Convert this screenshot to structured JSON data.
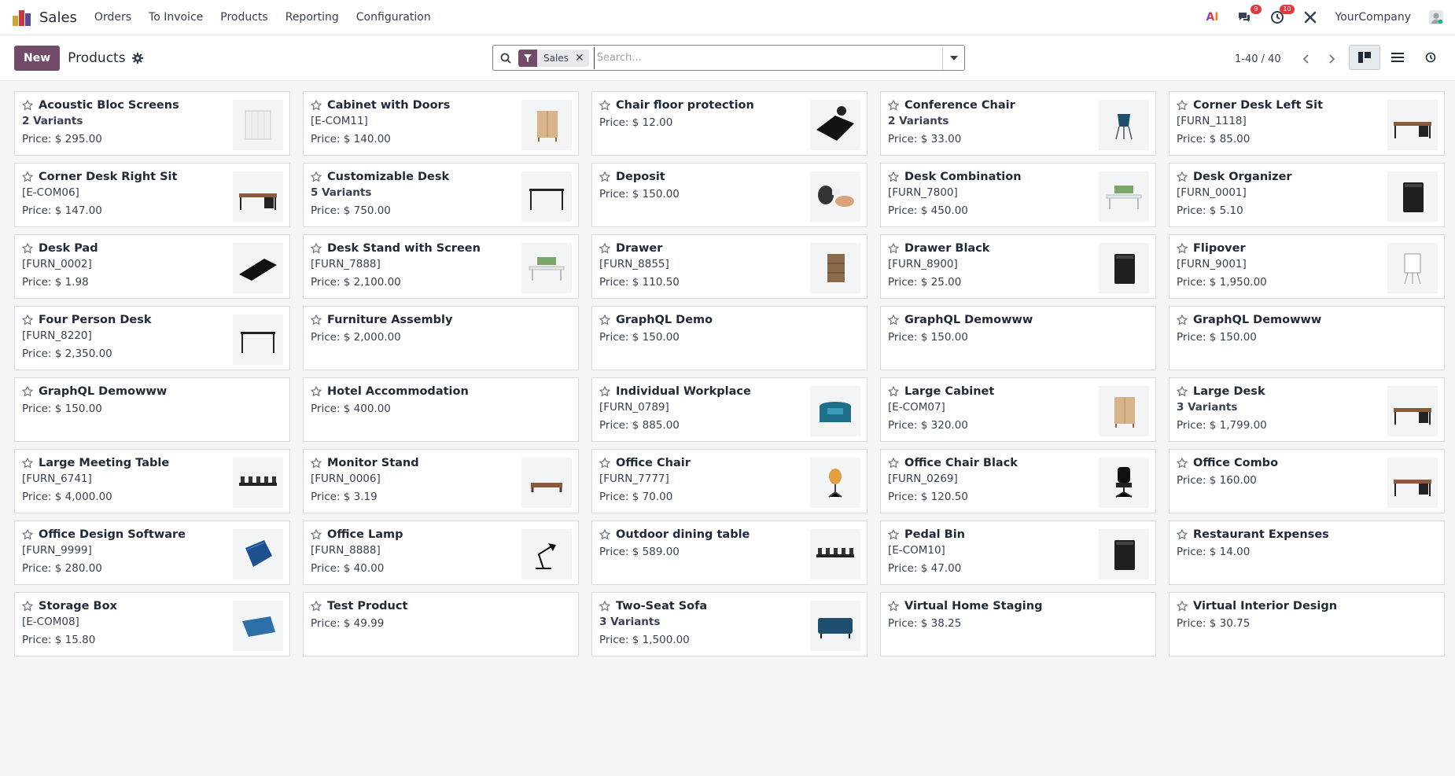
{
  "navbar": {
    "app_name": "Sales",
    "menu": [
      "Orders",
      "To Invoice",
      "Products",
      "Reporting",
      "Configuration"
    ],
    "ai_label": "AI",
    "messages_count": "9",
    "activities_count": "10",
    "company": "YourCompany"
  },
  "control": {
    "new_label": "New",
    "title": "Products",
    "facet_label": "Sales",
    "search_placeholder": "Search...",
    "pager": "1-40 / 40"
  },
  "products": [
    {
      "name": "Acoustic Bloc Screens",
      "sub": "2 Variants",
      "variants": true,
      "price": "Price: $ 295.00",
      "img": "screen"
    },
    {
      "name": "Cabinet with Doors",
      "sub": "[E-COM11]",
      "variants": false,
      "price": "Price: $ 140.00",
      "img": "cabinet"
    },
    {
      "name": "Chair floor protection",
      "sub": "",
      "variants": false,
      "price": "Price: $ 12.00",
      "img": "mat"
    },
    {
      "name": "Conference Chair",
      "sub": "2 Variants",
      "variants": true,
      "price": "Price: $ 33.00",
      "img": "chair-blue"
    },
    {
      "name": "Corner Desk Left Sit",
      "sub": "[FURN_1118]",
      "variants": false,
      "price": "Price: $ 85.00",
      "img": "desk"
    },
    {
      "name": "Corner Desk Right Sit",
      "sub": "[E-COM06]",
      "variants": false,
      "price": "Price: $ 147.00",
      "img": "desk"
    },
    {
      "name": "Customizable Desk",
      "sub": "5 Variants",
      "variants": true,
      "price": "Price: $ 750.00",
      "img": "desk-frame"
    },
    {
      "name": "Deposit",
      "sub": "",
      "variants": false,
      "price": "Price: $ 150.00",
      "img": "hands"
    },
    {
      "name": "Desk Combination",
      "sub": "[FURN_7800]",
      "variants": false,
      "price": "Price: $ 450.00",
      "img": "desk-white"
    },
    {
      "name": "Desk Organizer",
      "sub": "[FURN_0001]",
      "variants": false,
      "price": "Price: $ 5.10",
      "img": "box-black"
    },
    {
      "name": "Desk Pad",
      "sub": "[FURN_0002]",
      "variants": false,
      "price": "Price: $ 1.98",
      "img": "pad"
    },
    {
      "name": "Desk Stand with Screen",
      "sub": "[FURN_7888]",
      "variants": false,
      "price": "Price: $ 2,100.00",
      "img": "desk-white"
    },
    {
      "name": "Drawer",
      "sub": "[FURN_8855]",
      "variants": false,
      "price": "Price: $ 110.50",
      "img": "drawer-wood"
    },
    {
      "name": "Drawer Black",
      "sub": "[FURN_8900]",
      "variants": false,
      "price": "Price: $ 25.00",
      "img": "box-black"
    },
    {
      "name": "Flipover",
      "sub": "[FURN_9001]",
      "variants": false,
      "price": "Price: $ 1,950.00",
      "img": "flipover"
    },
    {
      "name": "Four Person Desk",
      "sub": "[FURN_8220]",
      "variants": false,
      "price": "Price: $ 2,350.00",
      "img": "desk-frame"
    },
    {
      "name": "Furniture Assembly",
      "sub": "",
      "variants": false,
      "price": "Price: $ 2,000.00",
      "img": ""
    },
    {
      "name": "GraphQL Demo",
      "sub": "",
      "variants": false,
      "price": "Price: $ 150.00",
      "img": ""
    },
    {
      "name": "GraphQL Demowww",
      "sub": "",
      "variants": false,
      "price": "Price: $ 150.00",
      "img": ""
    },
    {
      "name": "GraphQL Demowww",
      "sub": "",
      "variants": false,
      "price": "Price: $ 150.00",
      "img": ""
    },
    {
      "name": "GraphQL Demowww",
      "sub": "",
      "variants": false,
      "price": "Price: $ 150.00",
      "img": ""
    },
    {
      "name": "Hotel Accommodation",
      "sub": "",
      "variants": false,
      "price": "Price: $ 400.00",
      "img": ""
    },
    {
      "name": "Individual Workplace",
      "sub": "[FURN_0789]",
      "variants": false,
      "price": "Price: $ 885.00",
      "img": "workplace"
    },
    {
      "name": "Large Cabinet",
      "sub": "[E-COM07]",
      "variants": false,
      "price": "Price: $ 320.00",
      "img": "cabinet"
    },
    {
      "name": "Large Desk",
      "sub": "3 Variants",
      "variants": true,
      "price": "Price: $ 1,799.00",
      "img": "desk"
    },
    {
      "name": "Large Meeting Table",
      "sub": "[FURN_6741]",
      "variants": false,
      "price": "Price: $ 4,000.00",
      "img": "table"
    },
    {
      "name": "Monitor Stand",
      "sub": "[FURN_0006]",
      "variants": false,
      "price": "Price: $ 3.19",
      "img": "stand"
    },
    {
      "name": "Office Chair",
      "sub": "[FURN_7777]",
      "variants": false,
      "price": "Price: $ 70.00",
      "img": "chair-orange"
    },
    {
      "name": "Office Chair Black",
      "sub": "[FURN_0269]",
      "variants": false,
      "price": "Price: $ 120.50",
      "img": "chair-black"
    },
    {
      "name": "Office Combo",
      "sub": "",
      "variants": false,
      "price": "Price: $ 160.00",
      "img": "desk"
    },
    {
      "name": "Office Design Software",
      "sub": "[FURN_9999]",
      "variants": false,
      "price": "Price: $ 280.00",
      "img": "software"
    },
    {
      "name": "Office Lamp",
      "sub": "[FURN_8888]",
      "variants": false,
      "price": "Price: $ 40.00",
      "img": "lamp"
    },
    {
      "name": "Outdoor dining table",
      "sub": "",
      "variants": false,
      "price": "Price: $ 589.00",
      "img": "table"
    },
    {
      "name": "Pedal Bin",
      "sub": "[E-COM10]",
      "variants": false,
      "price": "Price: $ 47.00",
      "img": "box-black"
    },
    {
      "name": "Restaurant Expenses",
      "sub": "",
      "variants": false,
      "price": "Price: $ 14.00",
      "img": ""
    },
    {
      "name": "Storage Box",
      "sub": "[E-COM08]",
      "variants": false,
      "price": "Price: $ 15.80",
      "img": "storage"
    },
    {
      "name": "Test Product",
      "sub": "",
      "variants": false,
      "price": "Price: $ 49.99",
      "img": ""
    },
    {
      "name": "Two-Seat Sofa",
      "sub": "3 Variants",
      "variants": true,
      "price": "Price: $ 1,500.00",
      "img": "sofa"
    },
    {
      "name": "Virtual Home Staging",
      "sub": "",
      "variants": false,
      "price": "Price: $ 38.25",
      "img": ""
    },
    {
      "name": "Virtual Interior Design",
      "sub": "",
      "variants": false,
      "price": "Price: $ 30.75",
      "img": ""
    }
  ],
  "colors": {
    "brand": "#714b67",
    "badge": "#e0393e"
  }
}
